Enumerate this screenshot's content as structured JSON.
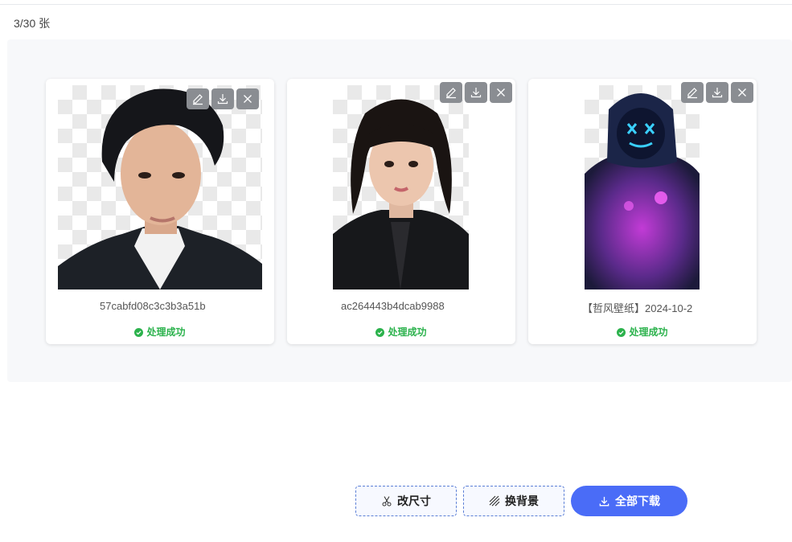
{
  "count_label": "3/30 张",
  "cards": [
    {
      "filename": "57cabfd08c3c3b3a51b",
      "status": "处理成功"
    },
    {
      "filename": "ac264443b4dcab9988",
      "status": "处理成功"
    },
    {
      "filename": "【哲风壁纸】2024-10-2",
      "status": "处理成功"
    }
  ],
  "card_actions": [
    "edit-icon",
    "download-icon",
    "close-icon"
  ],
  "buttons": {
    "resize": "改尺寸",
    "change_bg": "换背景",
    "download_all": "全部下载"
  },
  "colors": {
    "accent": "#4a6cf7",
    "success": "#2bb24c",
    "action_bg": "#8a8d92"
  }
}
